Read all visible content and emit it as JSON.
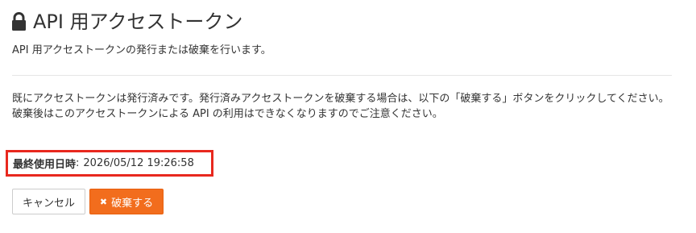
{
  "header": {
    "title": "API 用アクセストークン",
    "lock_icon": "lock-icon"
  },
  "subtitle": "API 用アクセストークンの発行または破棄を行います。",
  "body": {
    "line1": "既にアクセストークンは発行済みです。発行済みアクセストークンを破棄する場合は、以下の「破棄する」ボタンをクリックしてください。",
    "line2": "破棄後はこのアクセストークンによる API の利用はできなくなりますのでご注意ください。"
  },
  "last_used": {
    "label": "最終使用日時",
    "separator": ":",
    "value": "2026/05/12 19:26:58"
  },
  "actions": {
    "cancel_label": "キャンセル",
    "discard_label": "破棄する",
    "discard_icon": "close-icon"
  },
  "colors": {
    "accent_orange": "#f26d1d",
    "highlight_red": "#e8281e",
    "text": "#333333"
  }
}
